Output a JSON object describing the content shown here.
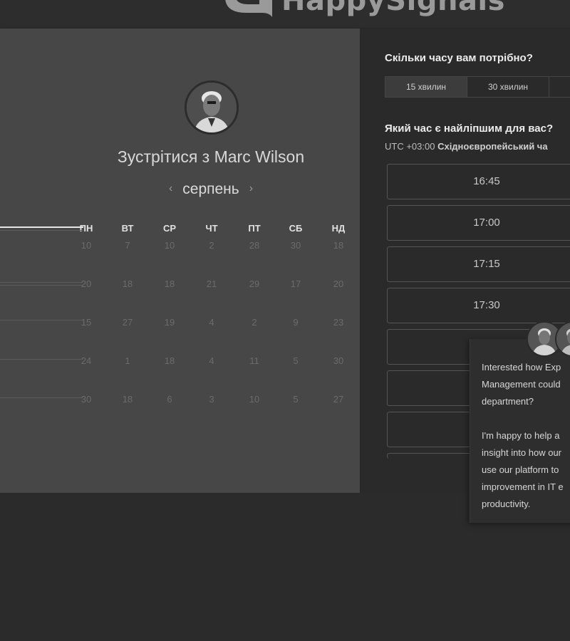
{
  "header": {
    "logo_text": "HappySignals",
    "logo_icon": "speech-bubble-icon"
  },
  "meeting": {
    "title": "Зустрітися з Marc Wilson",
    "month": "серпень",
    "prev_icon": "chevron-left-icon",
    "next_icon": "chevron-right-icon"
  },
  "calendar": {
    "weekdays": [
      "ПН",
      "ВТ",
      "СР",
      "ЧТ",
      "ПТ",
      "СБ",
      "НД"
    ],
    "weeks": [
      [
        "10",
        "7",
        "10",
        "2",
        "28",
        "30",
        "18"
      ],
      [
        "20",
        "18",
        "18",
        "21",
        "29",
        "17",
        "20"
      ],
      [
        "15",
        "27",
        "19",
        "4",
        "2",
        "9",
        "23"
      ],
      [
        "24",
        "1",
        "18",
        "4",
        "11",
        "5",
        "30"
      ],
      [
        "30",
        "18",
        "6",
        "3",
        "10",
        "5",
        "27"
      ]
    ]
  },
  "booking": {
    "duration_heading": "Скільки часу вам потрібно?",
    "durations": [
      "15 хвилин",
      "30 хвилин"
    ],
    "selected_duration": "15 хвилин",
    "time_heading": "Який час є найліпшим для вас?",
    "timezone_prefix": "UTC +03:00",
    "timezone_name": "Східноєвропейський ча",
    "slots": [
      "16:45",
      "17:00",
      "17:15",
      "17:30",
      "",
      "",
      ""
    ]
  },
  "chat": {
    "lines": [
      "Interested how Exp",
      "Management could",
      "department?",
      "",
      "I'm happy to help a",
      "insight into how our",
      "use our platform to",
      "improvement in IT e",
      "productivity."
    ]
  },
  "colors": {
    "left_panel": "#474747",
    "right_panel": "#2a2a2a",
    "background": "#2b2b2b",
    "text_light": "#ececec",
    "text_dim": "#6b6b6b"
  }
}
